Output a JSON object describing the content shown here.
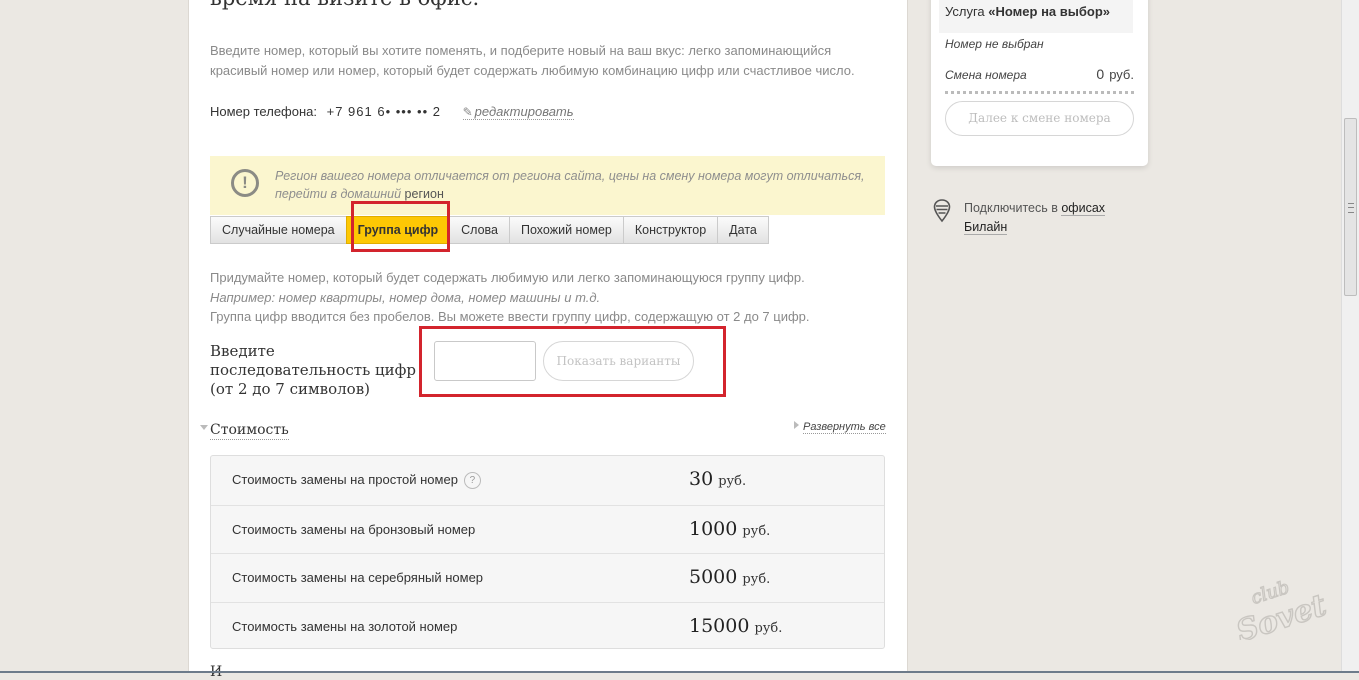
{
  "page": {
    "title": "время на визите в офис.",
    "intro": "Введите номер, который вы хотите поменять, и подберите новый на ваш вкус: легко запоминающийся красивый номер или номер, который будет содержать любимую комбинацию цифр или счастливое число.",
    "phone_label": "Номер телефона:",
    "phone_value": "+7 961 6• ••• •• 2",
    "edit_link": "редактировать"
  },
  "warning": {
    "text": "Регион вашего номера отличается от региона сайта, цены на смену номера могут отличаться, перейти в домашний",
    "link": "регион"
  },
  "tabs": [
    {
      "label": "Случайные номера",
      "active": false
    },
    {
      "label": "Группа цифр",
      "active": true
    },
    {
      "label": "Слова",
      "active": false
    },
    {
      "label": "Похожий номер",
      "active": false
    },
    {
      "label": "Конструктор",
      "active": false
    },
    {
      "label": "Дата",
      "active": false
    }
  ],
  "description": {
    "line1": "Придумайте номер, который будет содержать любимую или легко запоминающуюся группу цифр.",
    "line2": "Например: номер квартиры, номер дома, номер машины и т.д.",
    "line3": "Группа цифр вводится без пробелов. Вы можете ввести группу цифр, содержащую от 2 до 7 цифр."
  },
  "sequence": {
    "label": "Введите последовательность цифр (от 2 до 7 символов)",
    "input_value": "",
    "button": "Показать варианты"
  },
  "cost": {
    "heading": "Стоимость",
    "expand_all": "Развернуть все",
    "rows": [
      {
        "label": "Стоимость замены на простой номер",
        "help": "?",
        "value": "30",
        "unit": "руб."
      },
      {
        "label": "Стоимость замены на бронзовый номер",
        "value": "1000",
        "unit": "руб."
      },
      {
        "label": "Стоимость замены на серебряный номер",
        "value": "5000",
        "unit": "руб."
      },
      {
        "label": "Стоимость замены на золотой номер",
        "value": "15000",
        "unit": "руб."
      }
    ],
    "cut_text": "И"
  },
  "sidebar": {
    "service_prefix": "Услуга",
    "service_name": "«Номер на выбор»",
    "not_selected": "Номер не выбран",
    "change_label": "Смена номера",
    "change_value": "0",
    "change_unit": "руб.",
    "next_button": "Далее к смене номера",
    "office_prefix": "Подключитесь в",
    "office_link1": "офисах",
    "office_link2": "Билайн"
  },
  "watermark": "club Sovet",
  "colors": {
    "accent_yellow": "#fdc804",
    "warning_bg": "#fbf6cf",
    "annotation_red": "#d3242d",
    "page_bg": "#ebe8e3"
  }
}
